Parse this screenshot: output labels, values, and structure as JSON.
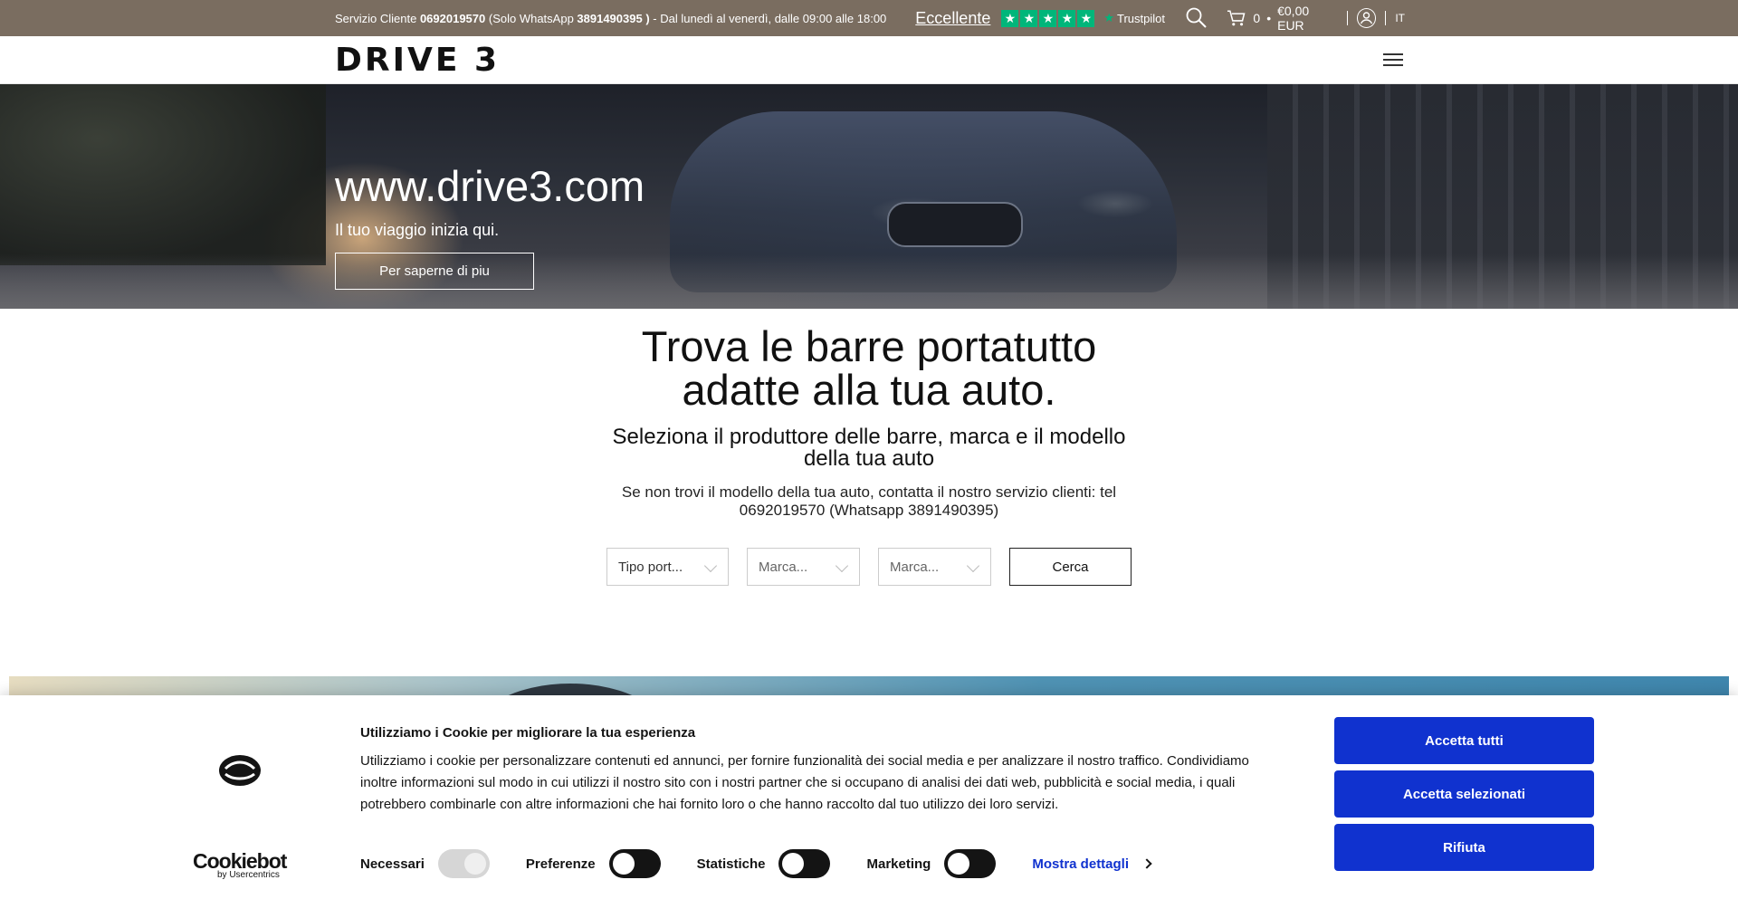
{
  "topbar": {
    "service_prefix": "Servizio Cliente ",
    "phone": "0692019570",
    "whatsapp_prefix": " (Solo WhatsApp ",
    "whatsapp": "3891490395",
    "whatsapp_suffix": " )",
    "hours": " - Dal lunedì al venerdì, dalle 09:00 alle 18:00",
    "trustpilot_label": "Eccellente",
    "trustpilot_brand": "Trustpilot",
    "trustpilot_color": "#00b67a",
    "cart_count": "0",
    "cart_bullet": "•",
    "cart_total": "€0,00 EUR",
    "language": "IT",
    "background": "#7a6d60"
  },
  "header": {
    "logo": "DRIVE 3"
  },
  "hero": {
    "title": "www.drive3.com",
    "subtitle": "Il tuo viaggio inizia qui.",
    "button": "Per saperne di piu"
  },
  "finder": {
    "title": "Trova le barre portatutto adatte alla tua auto.",
    "subtitle": "Seleziona il produttore delle barre, marca e il modello della tua auto",
    "note": "Se non trovi il modello della tua auto, contatta il nostro servizio clienti: tel 0692019570 (Whatsapp 3891490395)",
    "select_type": "Tipo port...",
    "select_make": "Marca...",
    "select_model": "Marca...",
    "search_button": "Cerca"
  },
  "cookie": {
    "brand": "Cookiebot",
    "brand_by": "by Usercentrics",
    "title": "Utilizziamo i Cookie per migliorare la tua esperienza",
    "body": "Utilizziamo i cookie per personalizzare contenuti ed annunci, per fornire funzionalità dei social media e per analizzare il nostro traffico. Condividiamo inoltre informazioni sul modo in cui utilizzi il nostro sito con i nostri partner che si occupano di analisi dei dati web, pubblicità e social media, i quali potrebbero combinarle con altre informazioni che hai fornito loro o che hanno raccolto dal tuo utilizzo dei loro servizi.",
    "toggles": {
      "necessary": "Necessari",
      "preferences": "Preferenze",
      "statistics": "Statistiche",
      "marketing": "Marketing"
    },
    "details_link": "Mostra dettagli",
    "accept_all": "Accetta tutti",
    "accept_selected": "Accetta selezionati",
    "reject": "Rifiuta",
    "button_color": "#1032cf"
  }
}
